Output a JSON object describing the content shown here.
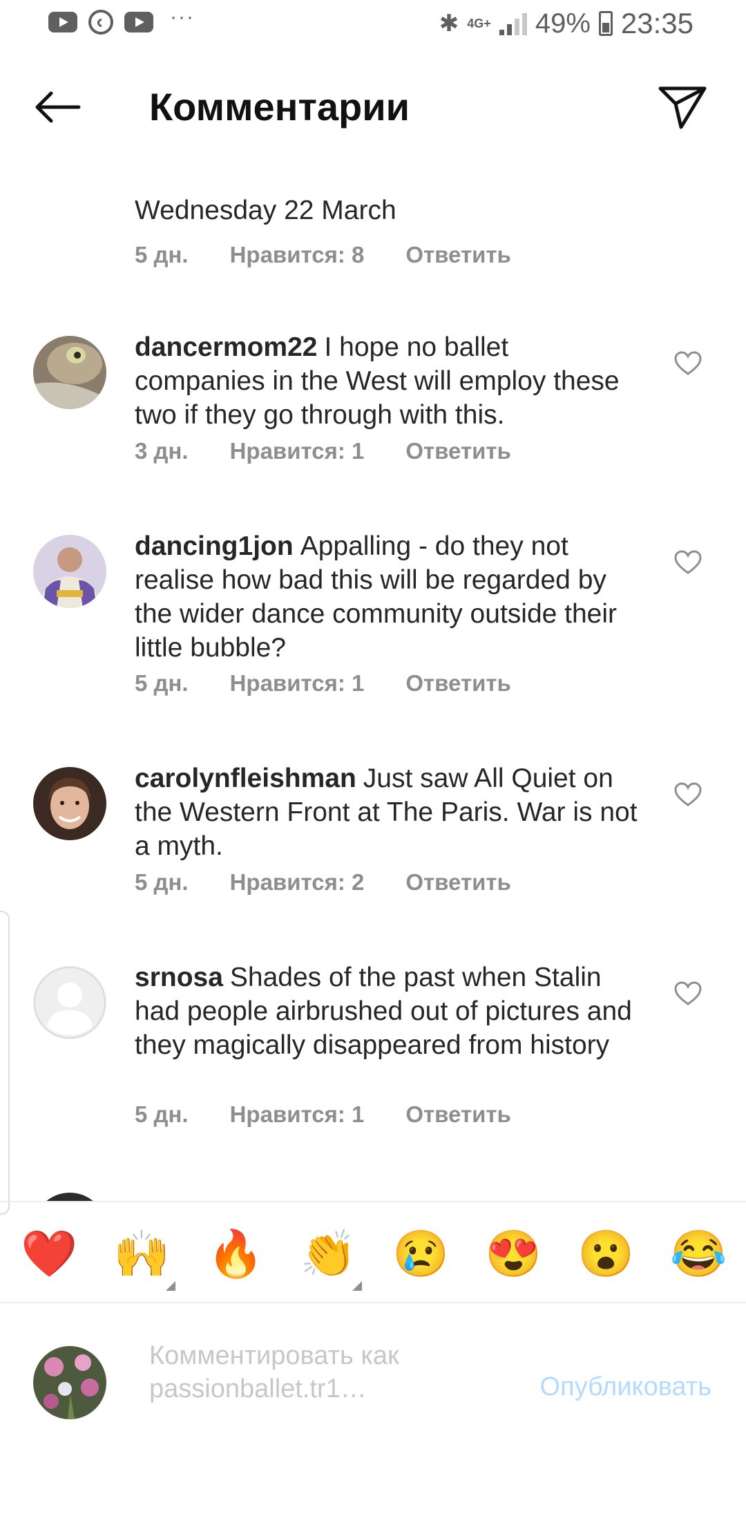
{
  "status_bar": {
    "left_icons": [
      "youtube-icon",
      "whatsapp-icon",
      "youtube-icon",
      "more-dots-icon"
    ],
    "network": "4G+",
    "battery": "49%",
    "time": "23:35"
  },
  "header": {
    "title": "Комментарии"
  },
  "comments": [
    {
      "username": "",
      "text": "Wednesday 22 March",
      "time": "5 дн.",
      "likes": "Нравится: 8",
      "reply": "Ответить"
    },
    {
      "username": "dancermom22",
      "text": "I hope no ballet companies in the West will employ these two if they go through with this.",
      "time": "3 дн.",
      "likes": "Нравится: 1",
      "reply": "Ответить"
    },
    {
      "username": "dancing1jon",
      "text": "Appalling - do they not realise how bad this will be regarded by the wider dance community outside their little bubble?",
      "time": "5 дн.",
      "likes": "Нравится: 1",
      "reply": "Ответить"
    },
    {
      "username": "carolynfleishman",
      "text": "Just saw All Quiet on the Western Front at The Paris. War is not a myth.",
      "time": "5 дн.",
      "likes": "Нравится: 2",
      "reply": "Ответить"
    },
    {
      "username": "srnosa",
      "text": "Shades of the past when Stalin had people airbrushed out of pictures and they magically disappeared from history",
      "time": "5 дн.",
      "likes": "Нравится: 1",
      "reply": "Ответить"
    }
  ],
  "emoji_bar": [
    "❤️",
    "🙌",
    "🔥",
    "👏",
    "😢",
    "😍",
    "😮",
    "😂"
  ],
  "composer": {
    "placeholder": "Комментировать как passionballet.tr1…",
    "publish_label": "Опубликовать"
  },
  "colors": {
    "text": "#262626",
    "meta": "#8e8e8e",
    "publish_disabled": "#b3dbff"
  }
}
